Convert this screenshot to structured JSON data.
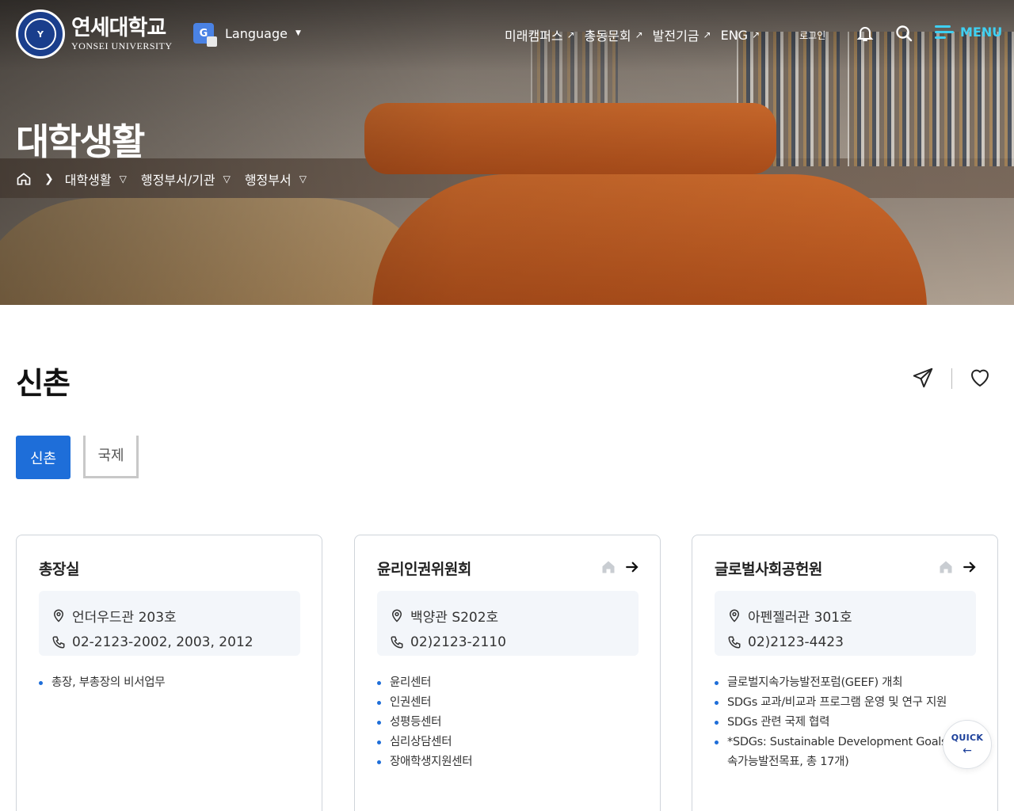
{
  "header": {
    "logo_ko": "연세대학교",
    "logo_en": "YONSEI UNIVERSITY",
    "language_label": "Language",
    "nav_links": [
      {
        "label": "미래캠퍼스"
      },
      {
        "label": "총동문회"
      },
      {
        "label": "발전기금"
      },
      {
        "label": "ENG"
      }
    ],
    "login_label": "로그인",
    "menu_label": "MENU",
    "accent_color": "#3fd0f2"
  },
  "hero": {
    "title": "대학생활",
    "breadcrumb": [
      "대학생활",
      "행정부서/기관",
      "행정부서"
    ]
  },
  "page": {
    "title": "신촌",
    "tabs": [
      {
        "label": "신촌",
        "active": true
      },
      {
        "label": "국제",
        "active": false
      }
    ],
    "primary_color": "#1e6ed9"
  },
  "cards": [
    {
      "title": "총장실",
      "location": "언더우드관 203호",
      "phone": "02-2123-2002, 2003, 2012",
      "has_links": false,
      "items": [
        "총장, 부총장의 비서업무"
      ]
    },
    {
      "title": "윤리인권위원회",
      "location": "백양관 S202호",
      "phone": "02)2123-2110",
      "has_links": true,
      "items": [
        "윤리센터",
        "인권센터",
        "성평등센터",
        "심리상담센터",
        "장애학생지원센터"
      ]
    },
    {
      "title": "글로벌사회공헌원",
      "location": "아펜젤러관 301호",
      "phone": "02)2123-4423",
      "has_links": true,
      "items": [
        "글로벌지속가능발전포럼(GEEF) 개최",
        "SDGs 교과/비교과 프로그램 운영 및 연구 지원",
        "SDGs 관련 국제 협력",
        "*SDGs: Sustainable Development Goals(지속가능발전목표, 총 17개)"
      ]
    }
  ],
  "quick": {
    "label": "QUICK"
  }
}
